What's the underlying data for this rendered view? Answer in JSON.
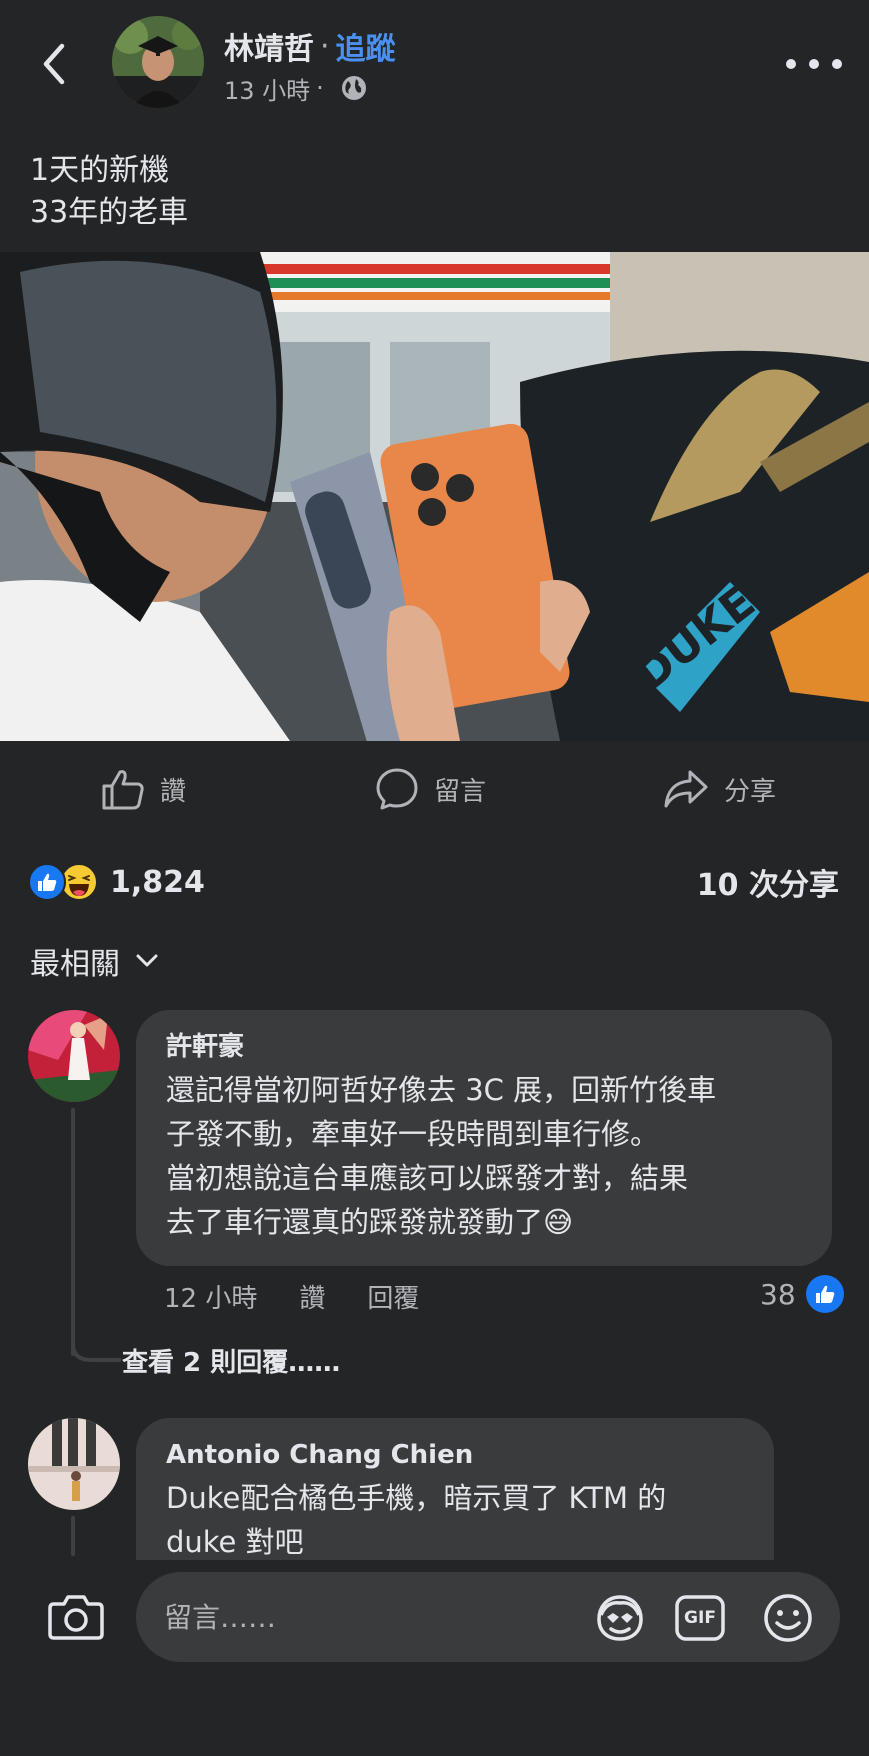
{
  "header": {
    "author": "林靖哲",
    "separator": "·",
    "follow_label": "追蹤",
    "time": "13 小時",
    "time_separator": "·",
    "audience_icon": "globe-icon"
  },
  "post": {
    "text": "1天的新機\n33年的老車"
  },
  "actions": {
    "like_label": "讚",
    "comment_label": "留言",
    "share_label": "分享"
  },
  "reactions": {
    "types": [
      "like",
      "haha"
    ],
    "count": "1,824",
    "shares": "10 次分享"
  },
  "sort": {
    "label": "最相關"
  },
  "comments": [
    {
      "name": "許軒豪",
      "lines": [
        "還記得當初阿哲好像去 3C 展，回新竹後車",
        "子發不動，牽車好一段時間到車行修。",
        "當初想說這台車應該可以踩發才對，結果",
        "去了車行還真的踩發就發動了😅"
      ],
      "time": "12 小時",
      "like_action": "讚",
      "reply_action": "回覆",
      "like_count": "38",
      "view_replies": "查看 2 則回覆……"
    },
    {
      "name": "Antonio Chang Chien",
      "lines": [
        "Duke配合橘色手機，暗示買了 KTM 的",
        "duke 對吧"
      ]
    }
  ],
  "composer": {
    "placeholder": "留言……",
    "icons": [
      "camera-icon",
      "avatar-sticker-icon",
      "gif-icon",
      "emoji-icon"
    ],
    "gif_label": "GIF"
  },
  "colors": {
    "background": "#242526",
    "bubble": "#3a3b3c",
    "accent_blue": "#4a90f0",
    "like_blue": "#1877f2",
    "secondary_text": "#b0b3b8"
  }
}
